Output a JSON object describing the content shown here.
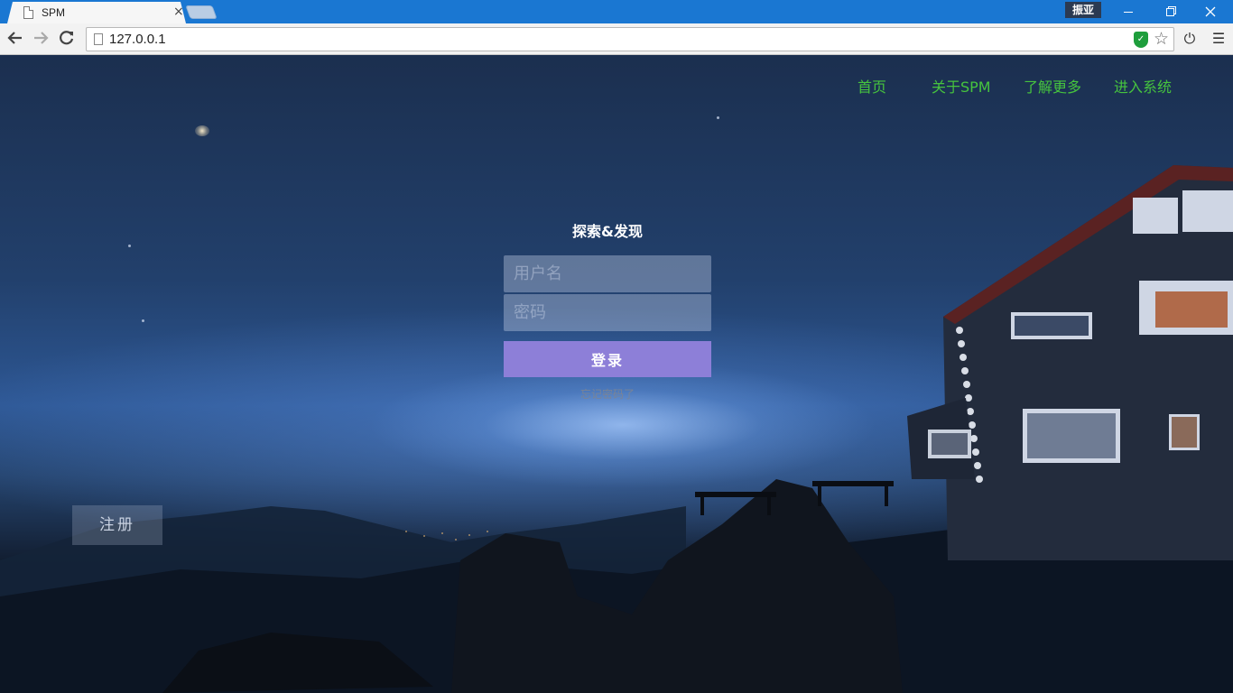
{
  "browser": {
    "tab_title": "SPM",
    "tab_close": "×",
    "user_badge": "振亚",
    "url": "127.0.0.1",
    "icons": [
      "back-arrow-icon",
      "forward-arrow-icon",
      "reload-icon",
      "page-icon",
      "shield-icon",
      "star-icon",
      "power-icon",
      "menu-icon"
    ]
  },
  "nav": {
    "home": "首页",
    "about": "关于SPM",
    "learn_more": "了解更多",
    "enter_system": "进入系统"
  },
  "login": {
    "title": "探索&发现",
    "username_placeholder": "用户名",
    "password_placeholder": "密码",
    "submit": "登录",
    "forgot": "忘记密码了"
  },
  "register": {
    "label": "注册"
  },
  "colors": {
    "nav_link": "#46c43e",
    "login_button": "#8d7fd8",
    "chrome_blue": "#1a77d2"
  }
}
